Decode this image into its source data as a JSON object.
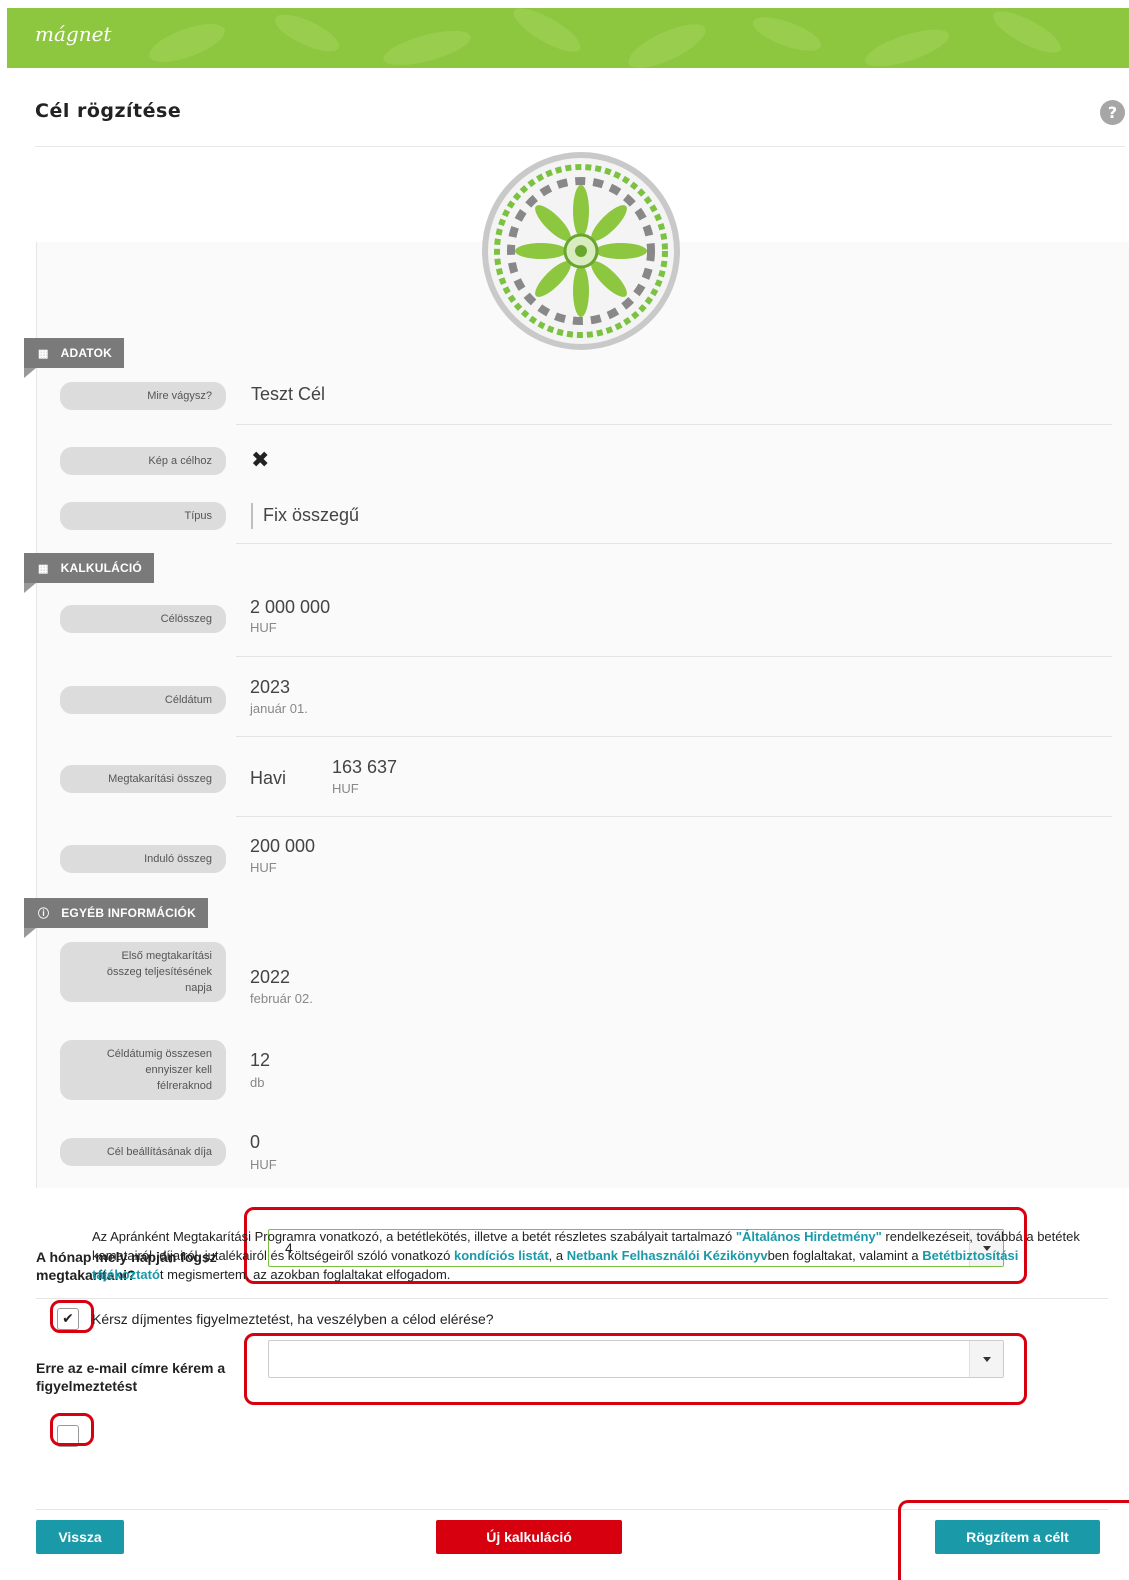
{
  "header": {
    "logo_text": "mágnet",
    "help_icon": "?"
  },
  "page": {
    "title": "Cél rögzítése"
  },
  "sections": {
    "adatok": {
      "label": "ADATOK",
      "icon": "table-icon"
    },
    "kalkulacio": {
      "label": "KALKULÁCIÓ",
      "icon": "calculator-icon"
    },
    "egyeb": {
      "label": "EGYÉB INFORMÁCIÓK",
      "icon": "info-icon"
    }
  },
  "fields": {
    "mire_vagysz": {
      "label": "Mire vágysz?",
      "value": "Teszt Cél"
    },
    "kep": {
      "label": "Kép a célhoz",
      "value": "✖"
    },
    "tipus": {
      "label": "Típus",
      "value": "Fix összegű"
    },
    "celosszeg": {
      "label": "Célösszeg",
      "value": "2 000 000",
      "unit": "HUF"
    },
    "celdatum": {
      "label": "Céldátum",
      "value": "2023",
      "sub": "január 01."
    },
    "megtakaritasi": {
      "label": "Megtakarítási összeg",
      "period": "Havi",
      "value": "163 637",
      "unit": "HUF"
    },
    "indulo": {
      "label": "Induló összeg",
      "value": "200 000",
      "unit": "HUF"
    },
    "elso": {
      "label_line1": "Első megtakarítási",
      "label_line2": "összeg teljesítésének",
      "label_line3": "napja",
      "value": "2022",
      "sub": "február 02."
    },
    "celdatumig": {
      "label_line1": "Céldátumig összesen",
      "label_line2": "ennyiszer kell",
      "label_line3": "félreraknod",
      "value": "12",
      "unit": "db"
    },
    "dij": {
      "label": "Cél beállításának díja",
      "value": "0",
      "unit": "HUF"
    }
  },
  "form": {
    "day_label": "A hónap mely napján fogsz megtakarítani?",
    "day_value": "4",
    "notify_checked": true,
    "notify_text": "Kérsz díjmentes figyelmeztetést, ha veszélyben a célod elérése?",
    "email_label": "Erre az e-mail címre kérem a figyelmeztetést",
    "email_value": "",
    "terms_checked": false,
    "terms": {
      "t1": "Az Apránként Megtakarítási Programra vonatkozó, a betétlekötés, illetve a betét részletes szabályait tartalmazó ",
      "l1": "\"Általános Hirdetmény\"",
      "t2": " rendelkezéseit, továbbá a betétek kamatairól, díjairól, jutalékairól és költségeiről szóló vonatkozó ",
      "l2": "kondíciós listát",
      "t3": ", a ",
      "l3": "Netbank Felhasználói Kézikönyv",
      "t4": "ben foglaltakat, valamint a ",
      "l4": "Betétbiztosítási tájékoztató",
      "t5": "t megismertem, az azokban foglaltakat elfogadom."
    }
  },
  "buttons": {
    "back": "Vissza",
    "new_calc": "Új kalkuláció",
    "submit": "Rögzítem a célt"
  },
  "colors": {
    "brand_green": "#8dc63f",
    "teal": "#1a9aa8",
    "red": "#d7000f",
    "section_grey": "#7a7a7a"
  }
}
